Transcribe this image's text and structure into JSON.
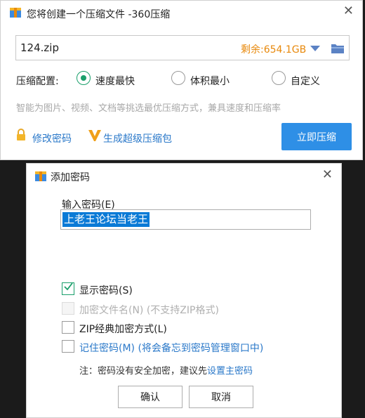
{
  "compress_window": {
    "title": "您将创建一个压缩文件 -360压缩",
    "archive_name": "124.zip",
    "free_space": "剩余:654.1GB",
    "config_label": "压缩配置:",
    "options": [
      "速度最快",
      "体积最小",
      "自定义"
    ],
    "selected_option": "速度最快",
    "hint": "智能为图片、视频、文档等挑选最优压缩方式，兼具速度和压缩率",
    "password_link": "修改密码",
    "super_link": "生成超级压缩包",
    "compress_button": "立即压缩",
    "colors": {
      "accent": "#2e8fe6",
      "radio": "#1a9f6b",
      "space": "#e8890c",
      "link": "#2a78c9"
    }
  },
  "password_dialog": {
    "title": "添加密码",
    "input_label": "输入密码(E)",
    "password_value": "上老王论坛当老王",
    "show_password": {
      "label": "显示密码(S)",
      "checked": true
    },
    "encrypt_names": {
      "label": "加密文件名(N) (不支持ZIP格式)",
      "checked": false,
      "disabled": true
    },
    "zip_classic": {
      "label": "ZIP经典加密方式(L)",
      "checked": false
    },
    "remember": {
      "label": "记住密码(M) (将会备忘到密码管理窗口中)",
      "checked": false
    },
    "note_prefix": "注：密码没有安全加密，建议先",
    "note_link": "设置主密码",
    "ok_button": "确认",
    "cancel_button": "取消"
  },
  "icons": [
    "app-icon",
    "close-icon",
    "dropdown-arrow-icon",
    "folder-icon",
    "lock-icon",
    "v-badge-icon",
    "checkmark-icon"
  ]
}
